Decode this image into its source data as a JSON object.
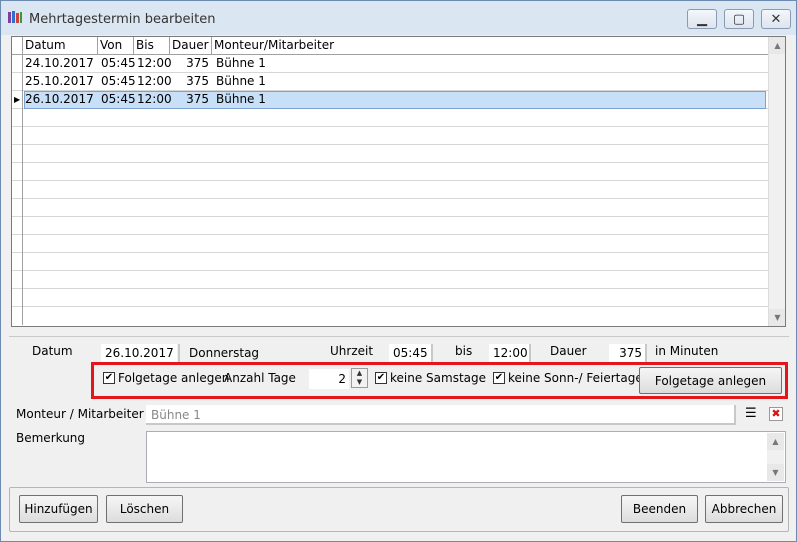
{
  "window": {
    "title": "Mehrtagestermin bearbeiten",
    "minimize": "▁",
    "maximize": "▢",
    "close": "✕"
  },
  "grid": {
    "columns": [
      "Datum",
      "Von",
      "Bis",
      "Dauer",
      "Monteur/Mitarbeiter"
    ],
    "rows": [
      {
        "datum": "24.10.2017",
        "von": "05:45",
        "bis": "12:00",
        "dauer": "375",
        "monteur": "Bühne 1"
      },
      {
        "datum": "25.10.2017",
        "von": "05:45",
        "bis": "12:00",
        "dauer": "375",
        "monteur": "Bühne 1"
      },
      {
        "datum": "26.10.2017",
        "von": "05:45",
        "bis": "12:00",
        "dauer": "375",
        "monteur": "Bühne 1"
      }
    ],
    "selected_marker": "▶"
  },
  "details": {
    "datum_label": "Datum",
    "datum_value": "26.10.2017",
    "weekday": "Donnerstag",
    "uhrzeit_label": "Uhrzeit",
    "uhrzeit_value": "05:45",
    "bis_label": "bis",
    "bis_value": "12:00",
    "dauer_label": "Dauer",
    "dauer_value": "375",
    "minuten_label": "in Minuten"
  },
  "folgetage": {
    "checkbox_label": "Folgetage anlegen",
    "anzahl_label": "Anzahl Tage",
    "anzahl_value": "2",
    "samstage_label": "keine Samstage",
    "sonn_label": "keine Sonn-/ Feiertage",
    "button_label": "Folgetage anlegen",
    "check_mark": "✔"
  },
  "monteur": {
    "label": "Monteur / Mitarbeiter",
    "value": "Bühne 1"
  },
  "bemerkung": {
    "label": "Bemerkung",
    "value": ""
  },
  "buttons": {
    "hinzufuegen": "Hinzufügen",
    "loeschen": "Löschen",
    "beenden": "Beenden",
    "abbrechen": "Abbrechen"
  },
  "colors": {
    "highlight_border": "#e4161c",
    "selected_row": "#c7dff7"
  }
}
